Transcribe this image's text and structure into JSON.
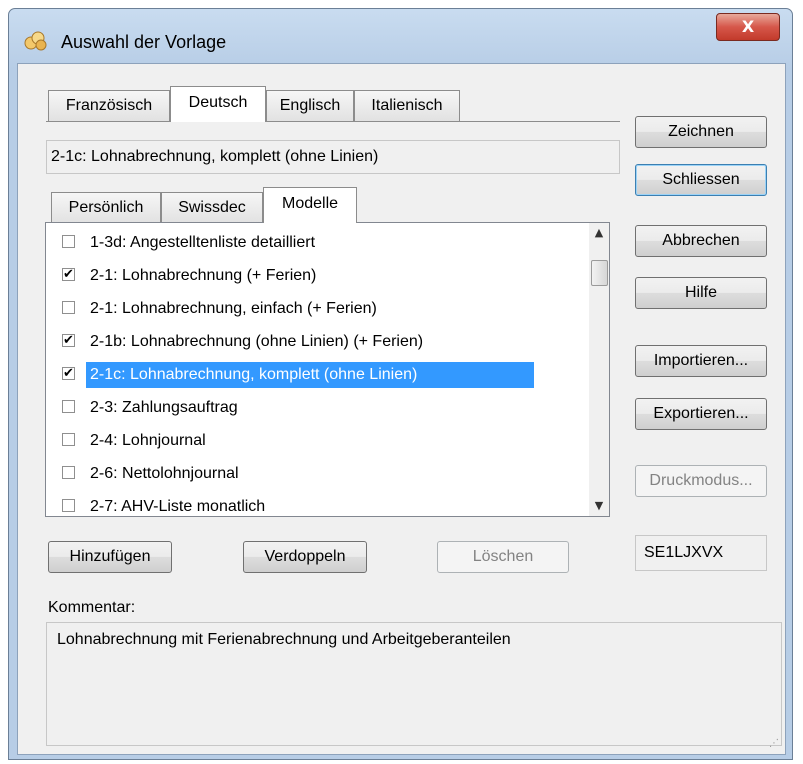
{
  "window": {
    "title": "Auswahl der Vorlage",
    "close_glyph": "X"
  },
  "language_tabs": [
    "Französisch",
    "Deutsch",
    "Englisch",
    "Italienisch"
  ],
  "selected_template": "2-1c: Lohnabrechnung, komplett (ohne Linien)",
  "category_tabs": [
    "Persönlich",
    "Swissdec",
    "Modelle"
  ],
  "list": {
    "items": [
      {
        "label": "1-3d: Angestelltenliste detailliert",
        "checked": false,
        "selected": false
      },
      {
        "label": "2-1: Lohnabrechnung (+ Ferien)",
        "checked": true,
        "selected": false
      },
      {
        "label": "2-1: Lohnabrechnung, einfach (+ Ferien)",
        "checked": false,
        "selected": false
      },
      {
        "label": "2-1b: Lohnabrechnung (ohne Linien) (+ Ferien)",
        "checked": true,
        "selected": false
      },
      {
        "label": "2-1c: Lohnabrechnung, komplett (ohne Linien)",
        "checked": true,
        "selected": true
      },
      {
        "label": "2-3: Zahlungsauftrag",
        "checked": false,
        "selected": false
      },
      {
        "label": "2-4: Lohnjournal",
        "checked": false,
        "selected": false
      },
      {
        "label": "2-6: Nettolohnjournal",
        "checked": false,
        "selected": false
      },
      {
        "label": "2-7: AHV-Liste monatlich",
        "checked": false,
        "selected": false
      }
    ],
    "scroll_up": "▲",
    "scroll_down": "▼"
  },
  "side_buttons": {
    "zeichnen": "Zeichnen",
    "schliessen": "Schliessen",
    "abbrechen": "Abbrechen",
    "hilfe": "Hilfe",
    "importieren": "Importieren...",
    "exportieren": "Exportieren...",
    "druckmodus": "Druckmodus..."
  },
  "bottom_buttons": {
    "hinzufuegen": "Hinzufügen",
    "verdoppeln": "Verdoppeln",
    "loeschen": "Löschen"
  },
  "code": "SE1LJXVX",
  "comment": {
    "label": "Kommentar:",
    "text": "Lohnabrechnung mit Ferienabrechnung und Arbeitgeberanteilen"
  },
  "colors": {
    "selection": "#3399ff",
    "close_button": "#c23a2b"
  }
}
